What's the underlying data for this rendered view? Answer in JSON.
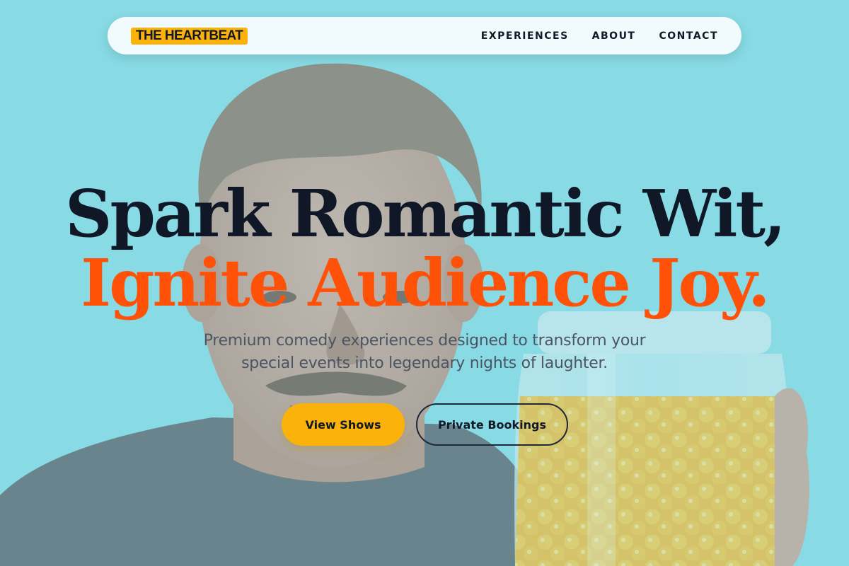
{
  "brand": {
    "logo_text": "THE HEARTBEAT",
    "logo_color": "#fbb20b"
  },
  "nav": {
    "items": [
      {
        "label": "EXPERIENCES"
      },
      {
        "label": "ABOUT"
      },
      {
        "label": "CONTACT"
      }
    ]
  },
  "hero": {
    "headline_line1": "Spark Romantic Wit,",
    "headline_line2": "Ignite Audience Joy.",
    "subtitle_line1": "Premium comedy experiences designed to transform your",
    "subtitle_line2": "special events into legendary nights of laughter.",
    "primary_button": "View Shows",
    "secondary_button": "Private Bookings",
    "background_image": "man-holding-jar-of-orange-candies"
  },
  "colors": {
    "background": "#86d8e3",
    "accent_orange": "#ff5208",
    "accent_yellow": "#fbb20b",
    "text_dark": "#101828",
    "text_muted": "#4b5563"
  }
}
